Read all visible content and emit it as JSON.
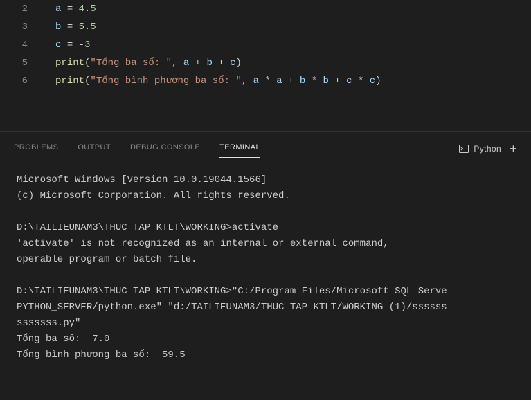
{
  "editor": {
    "lines": [
      {
        "n": "2",
        "tokens": [
          {
            "t": "a",
            "c": "tok-var"
          },
          {
            "t": " ",
            "c": "tok-op"
          },
          {
            "t": "=",
            "c": "tok-op"
          },
          {
            "t": " ",
            "c": "tok-op"
          },
          {
            "t": "4.5",
            "c": "tok-num"
          }
        ]
      },
      {
        "n": "3",
        "tokens": [
          {
            "t": "b",
            "c": "tok-var"
          },
          {
            "t": " ",
            "c": "tok-op"
          },
          {
            "t": "=",
            "c": "tok-op"
          },
          {
            "t": " ",
            "c": "tok-op"
          },
          {
            "t": "5.5",
            "c": "tok-num"
          }
        ]
      },
      {
        "n": "4",
        "tokens": [
          {
            "t": "c",
            "c": "tok-var"
          },
          {
            "t": " ",
            "c": "tok-op"
          },
          {
            "t": "=",
            "c": "tok-op"
          },
          {
            "t": " ",
            "c": "tok-op"
          },
          {
            "t": "-",
            "c": "tok-op"
          },
          {
            "t": "3",
            "c": "tok-num"
          }
        ]
      },
      {
        "n": "5",
        "tokens": [
          {
            "t": "print",
            "c": "tok-fn"
          },
          {
            "t": "(",
            "c": "tok-punc"
          },
          {
            "t": "\"Tổng ba số: \"",
            "c": "tok-str"
          },
          {
            "t": ", ",
            "c": "tok-punc"
          },
          {
            "t": "a",
            "c": "tok-var"
          },
          {
            "t": " ",
            "c": "tok-op"
          },
          {
            "t": "+",
            "c": "tok-op"
          },
          {
            "t": " ",
            "c": "tok-op"
          },
          {
            "t": "b",
            "c": "tok-var"
          },
          {
            "t": " ",
            "c": "tok-op"
          },
          {
            "t": "+",
            "c": "tok-op"
          },
          {
            "t": " ",
            "c": "tok-op"
          },
          {
            "t": "c",
            "c": "tok-var"
          },
          {
            "t": ")",
            "c": "tok-punc"
          }
        ]
      },
      {
        "n": "6",
        "tokens": [
          {
            "t": "print",
            "c": "tok-fn"
          },
          {
            "t": "(",
            "c": "tok-punc"
          },
          {
            "t": "\"Tổng bình phương ba số: \"",
            "c": "tok-str"
          },
          {
            "t": ", ",
            "c": "tok-punc"
          },
          {
            "t": "a",
            "c": "tok-var"
          },
          {
            "t": " ",
            "c": "tok-op"
          },
          {
            "t": "*",
            "c": "tok-op"
          },
          {
            "t": " ",
            "c": "tok-op"
          },
          {
            "t": "a",
            "c": "tok-var"
          },
          {
            "t": " ",
            "c": "tok-op"
          },
          {
            "t": "+",
            "c": "tok-op"
          },
          {
            "t": " ",
            "c": "tok-op"
          },
          {
            "t": "b",
            "c": "tok-var"
          },
          {
            "t": " ",
            "c": "tok-op"
          },
          {
            "t": "*",
            "c": "tok-op"
          },
          {
            "t": " ",
            "c": "tok-op"
          },
          {
            "t": "b",
            "c": "tok-var"
          },
          {
            "t": " ",
            "c": "tok-op"
          },
          {
            "t": "+",
            "c": "tok-op"
          },
          {
            "t": " ",
            "c": "tok-op"
          },
          {
            "t": "c",
            "c": "tok-var"
          },
          {
            "t": " ",
            "c": "tok-op"
          },
          {
            "t": "*",
            "c": "tok-op"
          },
          {
            "t": " ",
            "c": "tok-op"
          },
          {
            "t": "c",
            "c": "tok-var"
          },
          {
            "t": ")",
            "c": "tok-punc"
          }
        ]
      }
    ]
  },
  "panel": {
    "tabs": {
      "problems": "PROBLEMS",
      "output": "OUTPUT",
      "debug": "DEBUG CONSOLE",
      "terminal": "TERMINAL"
    },
    "interpreter": "Python",
    "plus": "+"
  },
  "terminal": {
    "text": "Microsoft Windows [Version 10.0.19044.1566]\n(c) Microsoft Corporation. All rights reserved.\n\nD:\\TAILIEUNAM3\\THUC TAP KTLT\\WORKING>activate\n'activate' is not recognized as an internal or external command,\noperable program or batch file.\n\nD:\\TAILIEUNAM3\\THUC TAP KTLT\\WORKING>\"C:/Program Files/Microsoft SQL Serve\nPYTHON_SERVER/python.exe\" \"d:/TAILIEUNAM3/THUC TAP KTLT/WORKING (1)/ssssss\nsssssss.py\"\nTổng ba số:  7.0\nTổng bình phương ba số:  59.5"
  }
}
